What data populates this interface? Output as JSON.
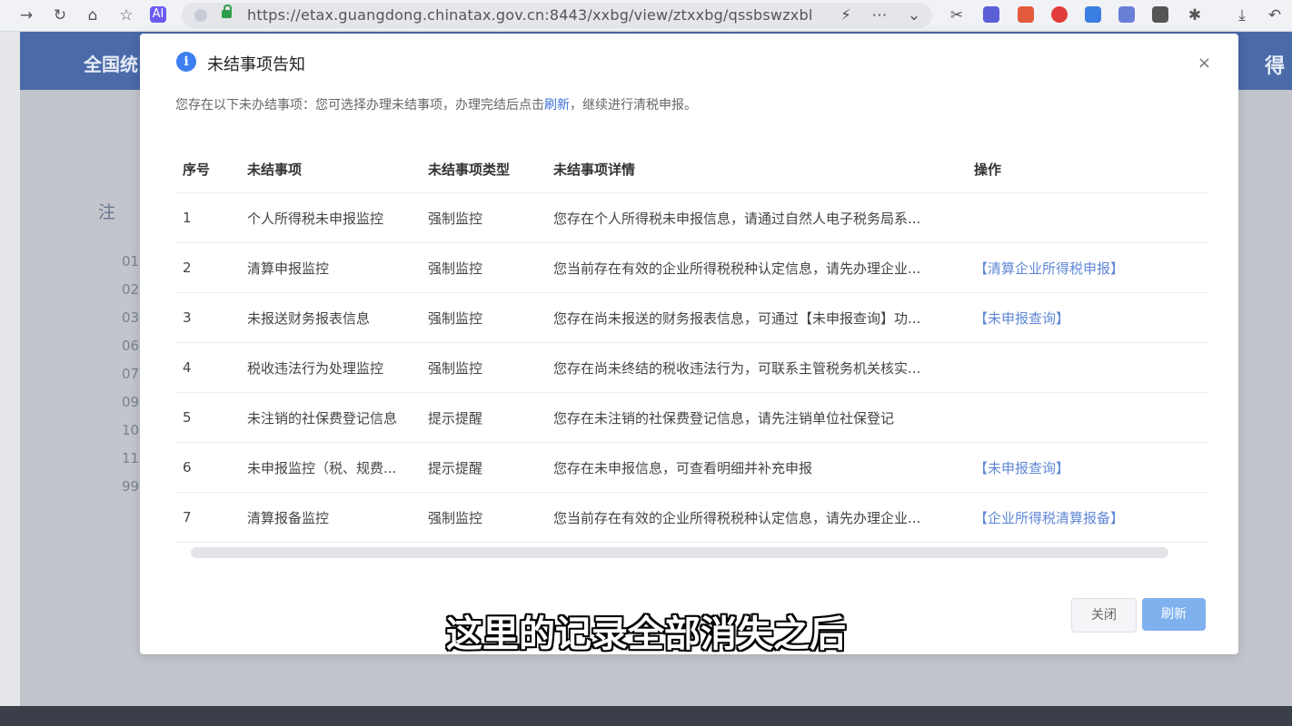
{
  "browser": {
    "url": "https://etax.guangdong.chinatax.gov.cn:8443/xxbg/view/ztxxbg/qssbswzxbl",
    "ai_badge": "AI"
  },
  "background": {
    "header_title": "全国统",
    "header_right": "得",
    "section_label": "注",
    "list_codes": [
      "01",
      "02",
      "03",
      "06",
      "07",
      "09",
      "10",
      "11",
      "99"
    ]
  },
  "modal": {
    "title": "未结事项告知",
    "close_symbol": "×",
    "notice_prefix": "您存在以下未办结事项：您可选择办理未结事项，办理完结后点击",
    "notice_link": "刷新",
    "notice_suffix": "，继续进行清税申报。",
    "columns": [
      "序号",
      "未结事项",
      "未结事项类型",
      "未结事项详情",
      "操作"
    ],
    "rows": [
      {
        "no": "1",
        "item": "个人所得税未申报监控",
        "type": "强制监控",
        "detail": "您存在个人所得税未申报信息，请通过自然人电子税务局系...",
        "action": ""
      },
      {
        "no": "2",
        "item": "清算申报监控",
        "type": "强制监控",
        "detail": "您当前存在有效的企业所得税税种认定信息，请先办理企业...",
        "action": "【清算企业所得税申报】"
      },
      {
        "no": "3",
        "item": "未报送财务报表信息",
        "type": "强制监控",
        "detail": "您存在尚未报送的财务报表信息，可通过【未申报查询】功...",
        "action": "【未申报查询】"
      },
      {
        "no": "4",
        "item": "税收违法行为处理监控",
        "type": "强制监控",
        "detail": "您存在尚未终结的税收违法行为，可联系主管税务机关核实...",
        "action": ""
      },
      {
        "no": "5",
        "item": "未注销的社保费登记信息",
        "type": "提示提醒",
        "detail": "您存在未注销的社保费登记信息，请先注销单位社保登记",
        "action": ""
      },
      {
        "no": "6",
        "item": "未申报监控（税、规费...",
        "type": "提示提醒",
        "detail": "您存在未申报信息，可查看明细并补充申报",
        "action": "【未申报查询】"
      },
      {
        "no": "7",
        "item": "清算报备监控",
        "type": "强制监控",
        "detail": "您当前存在有效的企业所得税税种认定信息，请先办理企业...",
        "action": "【企业所得税清算报备】"
      }
    ],
    "close_button": "关闭",
    "refresh_button": "刷新"
  },
  "subtitle": "这里的记录全部消失之后"
}
